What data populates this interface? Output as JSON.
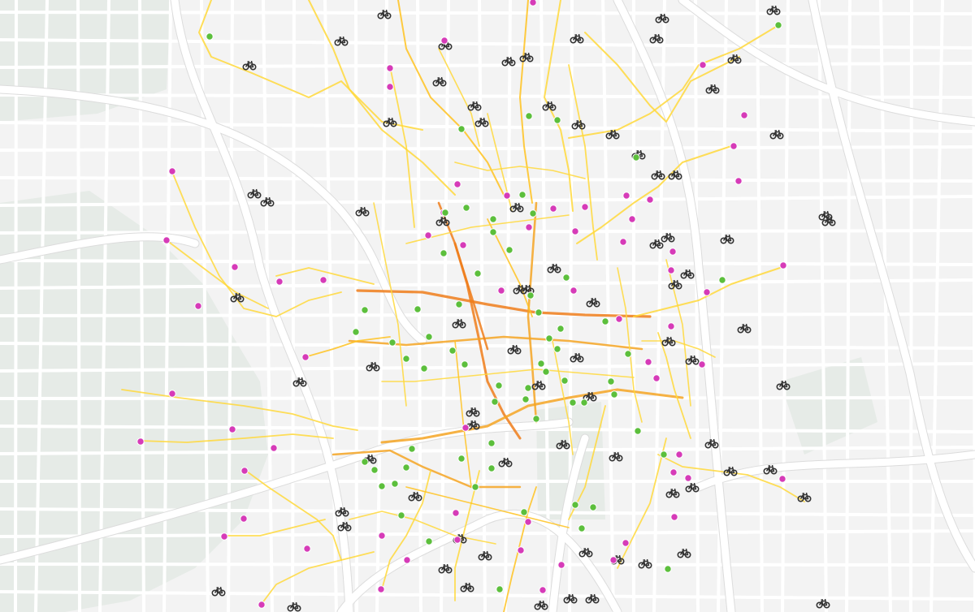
{
  "map": {
    "style": "light",
    "layers": {
      "routes": {
        "colors": [
          "#ffd83a",
          "#ffc21f",
          "#f5a523",
          "#ee7d1a"
        ]
      },
      "origins": {
        "color": "#d63bb8",
        "label": ""
      },
      "destinations": {
        "color": "#5cbf3c",
        "label": ""
      },
      "stations": {
        "icon": "bicycle-icon",
        "color": "#333333"
      }
    },
    "colors": {
      "background": "#f3f3f3",
      "park": "#e6ebe7",
      "road": "#ffffff",
      "route_light": "#ffd83a",
      "route_heavy": "#ee7d1a",
      "origin": "#d63bb8",
      "destination": "#5cbf3c",
      "station": "#333333"
    }
  }
}
